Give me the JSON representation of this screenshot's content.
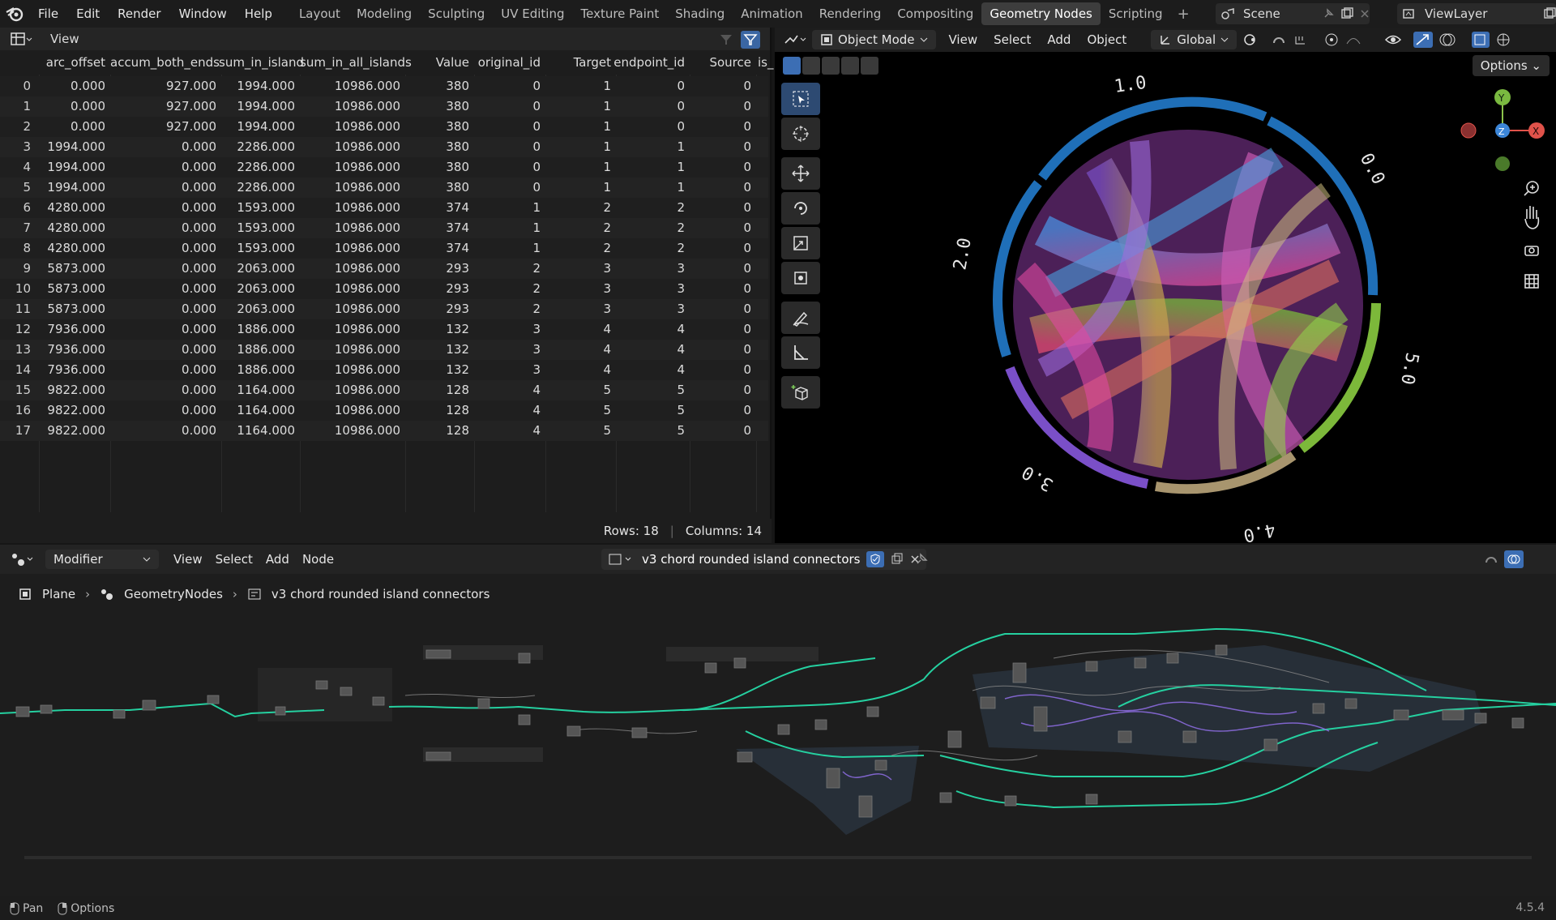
{
  "topbar": {
    "menus": [
      "File",
      "Edit",
      "Render",
      "Window",
      "Help"
    ],
    "workspaces": [
      "Layout",
      "Modeling",
      "Sculpting",
      "UV Editing",
      "Texture Paint",
      "Shading",
      "Animation",
      "Rendering",
      "Compositing",
      "Geometry Nodes",
      "Scripting"
    ],
    "active_workspace": "Geometry Nodes",
    "scene": "Scene",
    "view_layer": "ViewLayer"
  },
  "spreadsheet": {
    "view_label": "View",
    "columns": [
      "arc_offset",
      "accum_both_ends",
      "sum_in_island",
      "sum_in_all_islands",
      "Value",
      "original_id",
      "Target",
      "endpoint_id",
      "Source",
      "is_"
    ],
    "rows": [
      [
        "0.000",
        "927.000",
        "1994.000",
        "10986.000",
        "380",
        "0",
        "1",
        "0",
        "0"
      ],
      [
        "0.000",
        "927.000",
        "1994.000",
        "10986.000",
        "380",
        "0",
        "1",
        "0",
        "0"
      ],
      [
        "0.000",
        "927.000",
        "1994.000",
        "10986.000",
        "380",
        "0",
        "1",
        "0",
        "0"
      ],
      [
        "1994.000",
        "0.000",
        "2286.000",
        "10986.000",
        "380",
        "0",
        "1",
        "1",
        "0"
      ],
      [
        "1994.000",
        "0.000",
        "2286.000",
        "10986.000",
        "380",
        "0",
        "1",
        "1",
        "0"
      ],
      [
        "1994.000",
        "0.000",
        "2286.000",
        "10986.000",
        "380",
        "0",
        "1",
        "1",
        "0"
      ],
      [
        "4280.000",
        "0.000",
        "1593.000",
        "10986.000",
        "374",
        "1",
        "2",
        "2",
        "0"
      ],
      [
        "4280.000",
        "0.000",
        "1593.000",
        "10986.000",
        "374",
        "1",
        "2",
        "2",
        "0"
      ],
      [
        "4280.000",
        "0.000",
        "1593.000",
        "10986.000",
        "374",
        "1",
        "2",
        "2",
        "0"
      ],
      [
        "5873.000",
        "0.000",
        "2063.000",
        "10986.000",
        "293",
        "2",
        "3",
        "3",
        "0"
      ],
      [
        "5873.000",
        "0.000",
        "2063.000",
        "10986.000",
        "293",
        "2",
        "3",
        "3",
        "0"
      ],
      [
        "5873.000",
        "0.000",
        "2063.000",
        "10986.000",
        "293",
        "2",
        "3",
        "3",
        "0"
      ],
      [
        "7936.000",
        "0.000",
        "1886.000",
        "10986.000",
        "132",
        "3",
        "4",
        "4",
        "0"
      ],
      [
        "7936.000",
        "0.000",
        "1886.000",
        "10986.000",
        "132",
        "3",
        "4",
        "4",
        "0"
      ],
      [
        "7936.000",
        "0.000",
        "1886.000",
        "10986.000",
        "132",
        "3",
        "4",
        "4",
        "0"
      ],
      [
        "9822.000",
        "0.000",
        "1164.000",
        "10986.000",
        "128",
        "4",
        "5",
        "5",
        "0"
      ],
      [
        "9822.000",
        "0.000",
        "1164.000",
        "10986.000",
        "128",
        "4",
        "5",
        "5",
        "0"
      ],
      [
        "9822.000",
        "0.000",
        "1164.000",
        "10986.000",
        "128",
        "4",
        "5",
        "5",
        "0"
      ]
    ],
    "rows_label": "Rows: 18",
    "columns_label": "Columns: 14"
  },
  "viewport": {
    "mode": "Object Mode",
    "menus": [
      "View",
      "Select",
      "Add",
      "Object"
    ],
    "transform": "Global",
    "options": "Options",
    "ring_labels": [
      "1.0",
      "0.0",
      "5.0",
      "4.0",
      "3.0",
      "2.0"
    ],
    "gizmo": {
      "x": "X",
      "y": "Y",
      "z": "Z"
    },
    "colors": {
      "ring_blue": "#1f6fb8",
      "ring_green": "#7cb83a",
      "ring_pink": "#d94a9a",
      "ring_purple": "#7a4fc8",
      "ring_tan": "#a8956e"
    }
  },
  "node_editor": {
    "type": "Modifier",
    "menus": [
      "View",
      "Select",
      "Add",
      "Node"
    ],
    "tree_name": "v3 chord rounded island connectors",
    "breadcrumbs": [
      "Plane",
      "GeometryNodes",
      "v3 chord rounded island connectors"
    ]
  },
  "statusbar": {
    "pan": "Pan",
    "options": "Options",
    "version": "4.5.4"
  }
}
